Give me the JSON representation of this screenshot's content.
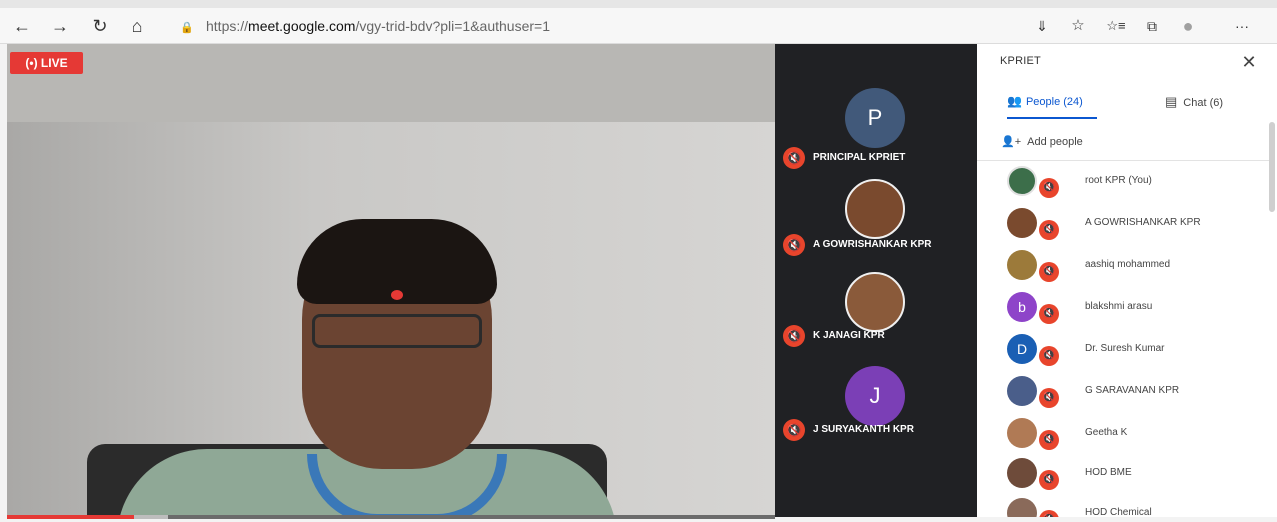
{
  "browser": {
    "back_icon": "←",
    "forward_icon": "→",
    "refresh_icon": "↻",
    "home_icon": "⌂",
    "lock_icon": "🔒",
    "url_scheme": "https://",
    "url_host": "meet.google.com",
    "url_path": "/vgy-trid-bdv?pli=1&authuser=1",
    "reader_icon": "⇓",
    "favorite_icon": "☆",
    "favorites_icon": "☆≡",
    "collections_icon": "⧉",
    "profile_icon": "●",
    "more_icon": "···"
  },
  "video": {
    "live_label": "(•) LIVE"
  },
  "tiles": [
    {
      "name": "PRINCIPAL KPRIET",
      "initial": "P",
      "color": "#41597a",
      "photo": false
    },
    {
      "name": "A GOWRISHANKAR KPR",
      "initial": "",
      "color": "#7a4a2e",
      "photo": true
    },
    {
      "name": "K JANAGI KPR",
      "initial": "",
      "color": "#8a5a3a",
      "photo": true
    },
    {
      "name": "J SURYAKANTH KPR",
      "initial": "J",
      "color": "#7b3fb6",
      "photo": false
    }
  ],
  "panel": {
    "title": "KPRIET",
    "close_icon": "✕",
    "tab_people": "People (24)",
    "tab_chat": "Chat (6)",
    "people_icon": "👥",
    "chat_icon": "▤",
    "add_people": "Add people",
    "add_people_icon": "+",
    "people": [
      {
        "name": "root KPR (You)",
        "initial": "",
        "color": "#3c6e4a"
      },
      {
        "name": "A GOWRISHANKAR KPR",
        "initial": "",
        "color": "#7a4a2e"
      },
      {
        "name": "aashiq mohammed",
        "initial": "",
        "color": "#9c7a3a"
      },
      {
        "name": "blakshmi arasu",
        "initial": "b",
        "color": "#8e44c9"
      },
      {
        "name": "Dr. Suresh Kumar",
        "initial": "D",
        "color": "#1a5fb4"
      },
      {
        "name": "G SARAVANAN KPR",
        "initial": "",
        "color": "#4a5e8a"
      },
      {
        "name": "Geetha K",
        "initial": "",
        "color": "#b07a55"
      },
      {
        "name": "HOD BME",
        "initial": "",
        "color": "#6e4b3a"
      },
      {
        "name": "HOD Chemical",
        "initial": "",
        "color": "#8a6a5a"
      }
    ]
  }
}
